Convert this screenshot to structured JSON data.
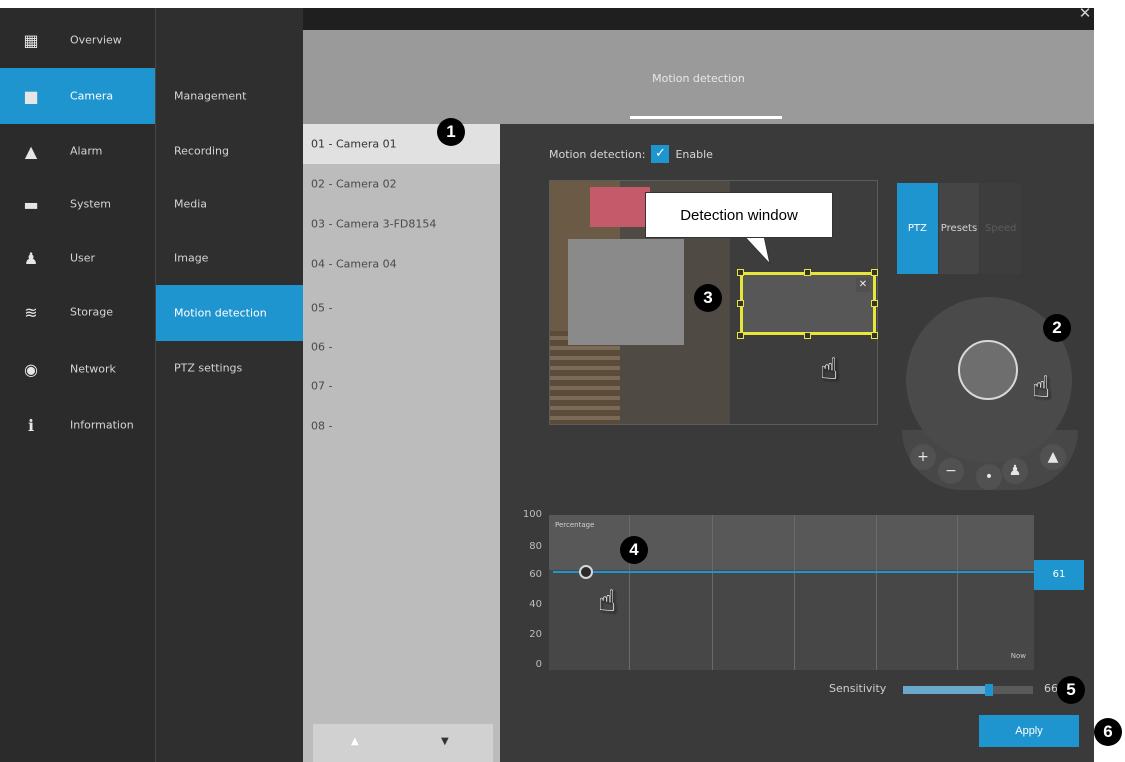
{
  "window": {
    "close_glyph": "✕"
  },
  "nav": {
    "items": [
      {
        "label": "Overview",
        "icon": "overview-icon",
        "glyph": "▦"
      },
      {
        "label": "Camera",
        "icon": "camera-icon",
        "glyph": "■"
      },
      {
        "label": "Alarm",
        "icon": "alarm-bell-icon",
        "glyph": "▲"
      },
      {
        "label": "System",
        "icon": "system-monitor-icon",
        "glyph": "▬"
      },
      {
        "label": "User",
        "icon": "user-icon",
        "glyph": "♟"
      },
      {
        "label": "Storage",
        "icon": "storage-database-icon",
        "glyph": "≋"
      },
      {
        "label": "Network",
        "icon": "network-globe-icon",
        "glyph": "◉"
      },
      {
        "label": "Information",
        "icon": "information-icon",
        "glyph": "ℹ"
      }
    ],
    "active": "Camera"
  },
  "subnav": {
    "items": [
      "Management",
      "Recording",
      "Media",
      "Image",
      "Motion detection",
      "PTZ settings"
    ],
    "active": "Motion detection"
  },
  "header": {
    "title": "Motion detection"
  },
  "camera_list": {
    "items": [
      "01 - Camera 01",
      "02 - Camera 02",
      "03 - Camera 3-FD8154",
      "04 - Camera 04",
      "05 -",
      "06 -",
      "07 -",
      "08 -"
    ],
    "active": "01 - Camera 01",
    "up_glyph": "▲",
    "down_glyph": "▼"
  },
  "motion": {
    "label": "Motion detection:",
    "enable_label": "Enable",
    "enabled": true,
    "check_glyph": "✓"
  },
  "callout": {
    "text": "Detection window"
  },
  "detection_window": {
    "close_glyph": "✕"
  },
  "ptz": {
    "tabs": [
      "PTZ",
      "Presets",
      "Speed"
    ],
    "active": "PTZ",
    "zoom_in": "+",
    "zoom_out": "−",
    "home": "•",
    "person": "♟",
    "scene": "▲"
  },
  "chart": {
    "label": "Percentage",
    "now_label": "Now",
    "y_ticks": [
      "100",
      "80",
      "60",
      "40",
      "20",
      "0"
    ],
    "threshold_value": "61"
  },
  "sensitivity": {
    "label": "Sensitivity",
    "value": "66",
    "level": 0.66
  },
  "apply_label": "Apply",
  "markers": [
    "1",
    "2",
    "3",
    "4",
    "5",
    "6"
  ],
  "hand_glyph": "☝",
  "colors": {
    "accent": "#1f95cf",
    "detection_window": "#e8e63a",
    "sidebar": "#2b2b2b",
    "content": "#3a3a3a"
  }
}
